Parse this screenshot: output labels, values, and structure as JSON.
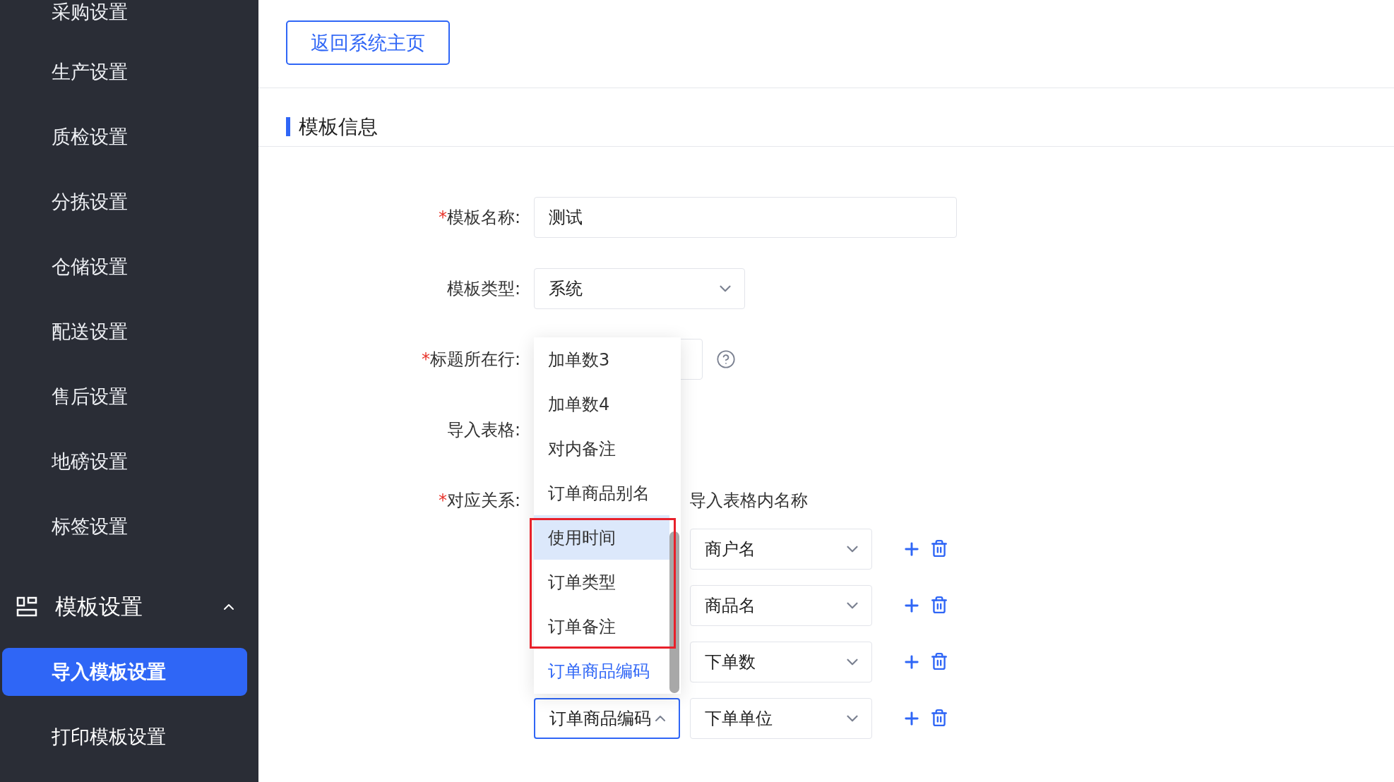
{
  "sidebar": {
    "items": [
      {
        "label": "采购设置",
        "selected": false
      },
      {
        "label": "生产设置",
        "selected": false
      },
      {
        "label": "质检设置",
        "selected": false
      },
      {
        "label": "分拣设置",
        "selected": false
      },
      {
        "label": "仓储设置",
        "selected": false
      },
      {
        "label": "配送设置",
        "selected": false
      },
      {
        "label": "售后设置",
        "selected": false
      },
      {
        "label": "地磅设置",
        "selected": false
      },
      {
        "label": "标签设置",
        "selected": false
      }
    ],
    "group": {
      "label": "模板设置",
      "expanded": true,
      "children": [
        {
          "label": "导入模板设置",
          "selected": true
        },
        {
          "label": "打印模板设置",
          "selected": false
        }
      ]
    }
  },
  "header": {
    "back_button": "返回系统主页"
  },
  "section": {
    "title": "模板信息"
  },
  "form": {
    "name": {
      "label": "模板名称:",
      "required_mark": "*",
      "value": "测试"
    },
    "type": {
      "label": "模板类型:",
      "value": "系统"
    },
    "title_row": {
      "label": "标题所在行:",
      "required_mark": "*"
    },
    "import_table": {
      "label": "导入表格:"
    },
    "mapping": {
      "label": "对应关系:",
      "required_mark": "*",
      "column_header": "导入表格内名称",
      "rows": [
        {
          "target": "商户名"
        },
        {
          "target": "商品名"
        },
        {
          "target": "下单数"
        },
        {
          "target": "下单单位",
          "source": "订单商品编码",
          "open": true
        }
      ],
      "options": [
        {
          "label": "加单数3",
          "highlighted": false,
          "selected": false
        },
        {
          "label": "加单数4",
          "highlighted": false,
          "selected": false
        },
        {
          "label": "对内备注",
          "highlighted": false,
          "selected": false
        },
        {
          "label": "订单商品别名",
          "highlighted": false,
          "selected": false
        },
        {
          "label": "使用时间",
          "highlighted": true,
          "selected": false
        },
        {
          "label": "订单类型",
          "highlighted": false,
          "selected": false
        },
        {
          "label": "订单备注",
          "highlighted": false,
          "selected": false
        },
        {
          "label": "订单商品编码",
          "highlighted": false,
          "selected": true
        }
      ]
    }
  }
}
